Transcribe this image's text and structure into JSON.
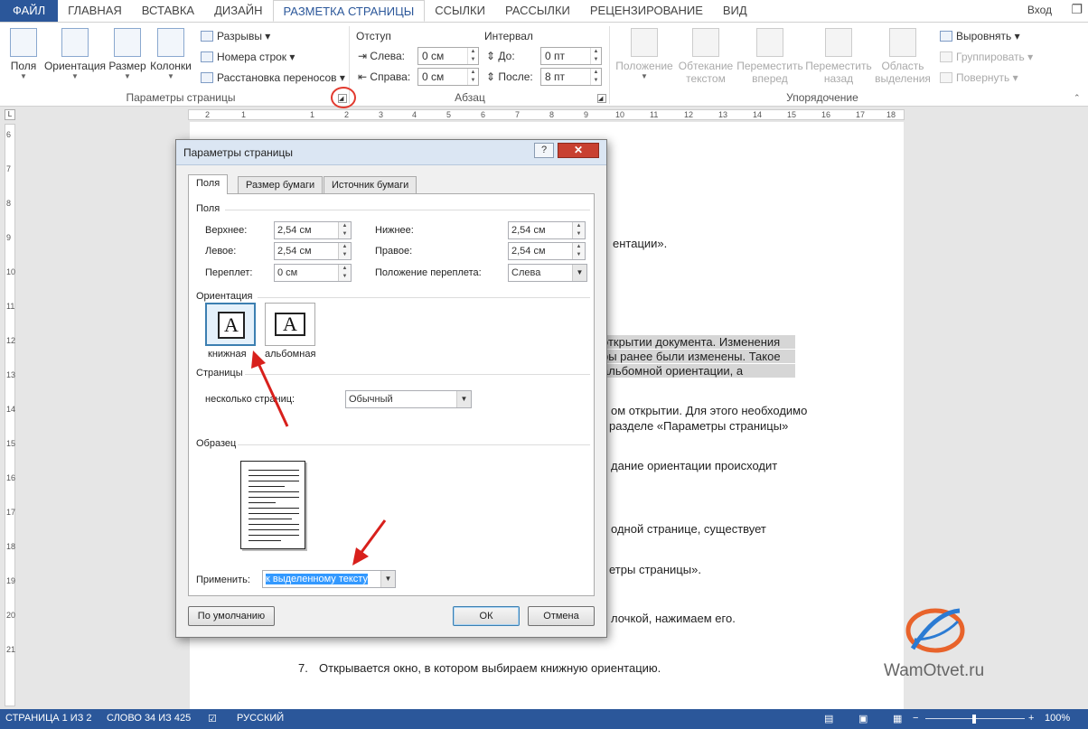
{
  "tabs": {
    "file": "ФАЙЛ",
    "items": [
      "ГЛАВНАЯ",
      "ВСТАВКА",
      "ДИЗАЙН",
      "РАЗМЕТКА СТРАНИЦЫ",
      "ССЫЛКИ",
      "РАССЫЛКИ",
      "РЕЦЕНЗИРОВАНИЕ",
      "ВИД"
    ],
    "active_index": 3,
    "signin": "Вход"
  },
  "ribbon": {
    "page_setup": {
      "margins": "Поля",
      "orientation": "Ориентация",
      "size": "Размер",
      "columns": "Колонки",
      "breaks": "Разрывы",
      "line_numbers": "Номера строк",
      "hyphenation": "Расстановка переносов",
      "group_label": "Параметры страницы"
    },
    "paragraph": {
      "indent_title": "Отступ",
      "spacing_title": "Интервал",
      "left_label": "Слева:",
      "left_value": "0 см",
      "right_label": "Справа:",
      "right_value": "0 см",
      "before_label": "До:",
      "before_value": "0 пт",
      "after_label": "После:",
      "after_value": "8 пт",
      "group_label": "Абзац"
    },
    "arrange": {
      "position": "Положение",
      "wrap_line1": "Обтекание",
      "wrap_line2": "текстом",
      "forward_line1": "Переместить",
      "forward_line2": "вперед",
      "backward_line1": "Переместить",
      "backward_line2": "назад",
      "selection_line1": "Область",
      "selection_line2": "выделения",
      "align": "Выровнять",
      "group": "Группировать",
      "rotate": "Повернуть",
      "group_label": "Упорядочение"
    }
  },
  "document": {
    "lines": [
      "ентации».",
      "открытии документа. Изменения",
      "ры ранее были изменены. Такое",
      "альбомной ориентации, а",
      "ом открытии. Для этого необходимо",
      "разделе «Параметры страницы»",
      "дание ориентации происходит",
      "одной странице, существует",
      "етры страницы».",
      "лочкой, нажимаем его."
    ],
    "item7_number": "7.",
    "item7_text": "Открывается окно, в котором выбираем книжную ориентацию.",
    "watermark": "WamOtvet.ru"
  },
  "dialog": {
    "title": "Параметры страницы",
    "help": "?",
    "close": "✕",
    "tabs": [
      "Поля",
      "Размер бумаги",
      "Источник бумаги"
    ],
    "margins_section": "Поля",
    "top_label": "Верхнее:",
    "top_value": "2,54 см",
    "bottom_label": "Нижнее:",
    "bottom_value": "2,54 см",
    "left_label": "Левое:",
    "left_value": "2,54 см",
    "right_label": "Правое:",
    "right_value": "2,54 см",
    "gutter_label": "Переплет:",
    "gutter_value": "0 см",
    "gutter_pos_label": "Положение переплета:",
    "gutter_pos_value": "Слева",
    "orientation_section": "Ориентация",
    "portrait": "книжная",
    "landscape": "альбомная",
    "orientation_glyph": "A",
    "pages_section": "Страницы",
    "multiple_pages_label": "несколько страниц:",
    "multiple_pages_value": "Обычный",
    "preview_section": "Образец",
    "apply_label": "Применить:",
    "apply_value": "к выделенному тексту",
    "default_button": "По умолчанию",
    "ok_button": "ОК",
    "cancel_button": "Отмена"
  },
  "status": {
    "page": "СТРАНИЦА 1 ИЗ 2",
    "words": "СЛОВО 34 ИЗ 425",
    "language": "РУССКИЙ",
    "zoom": "100%"
  },
  "ruler": {
    "h_ticks": [
      "2",
      "1",
      "1",
      "2",
      "3",
      "4",
      "5",
      "6",
      "7",
      "8",
      "9",
      "10",
      "11",
      "12",
      "13",
      "14",
      "15",
      "16",
      "17",
      "18"
    ],
    "v_ticks": [
      "6",
      "7",
      "8",
      "9",
      "10",
      "11",
      "12",
      "13",
      "14",
      "15",
      "16",
      "17",
      "18",
      "19",
      "20",
      "21"
    ]
  },
  "colors": {
    "accent": "#2b579a",
    "highlight_circle": "#e23a2f",
    "annotation_arrow": "#d8201c"
  }
}
